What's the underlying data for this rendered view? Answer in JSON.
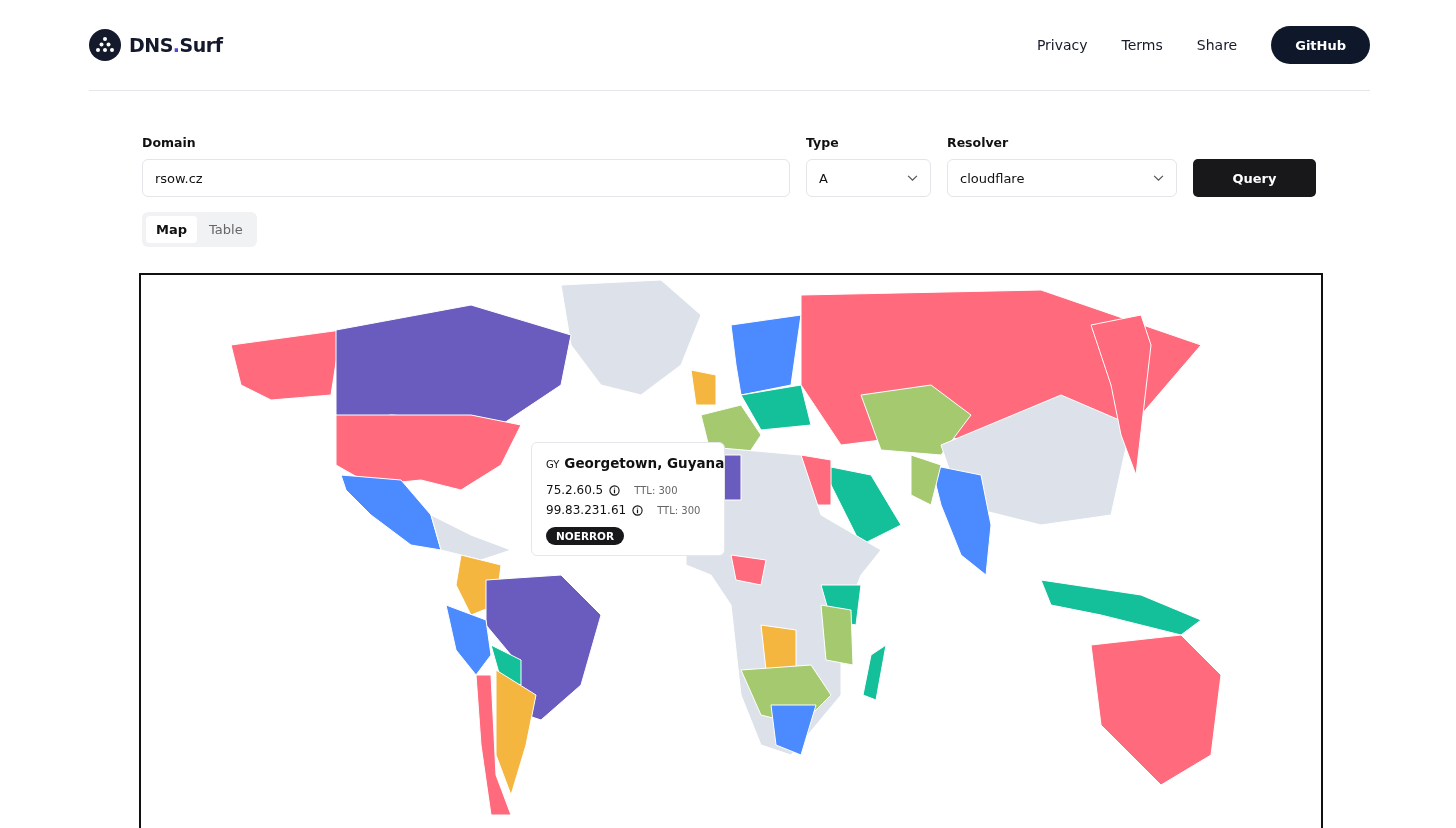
{
  "header": {
    "brand": {
      "name": "DNS",
      "dot": ".",
      "suffix": "Surf"
    },
    "nav": [
      "Privacy",
      "Terms",
      "Share"
    ],
    "cta": "GitHub"
  },
  "form": {
    "domain": {
      "label": "Domain",
      "value": "rsow.cz"
    },
    "type": {
      "label": "Type",
      "value": "A"
    },
    "resolver": {
      "label": "Resolver",
      "value": "cloudflare"
    },
    "submit": "Query"
  },
  "view_tabs": [
    {
      "label": "Map",
      "selected": true
    },
    {
      "label": "Table",
      "selected": false
    }
  ],
  "tooltip": {
    "country_code": "GY",
    "location": "Georgetown, Guyana",
    "records": [
      {
        "ip": "75.2.60.5",
        "ttl": "TTL: 300"
      },
      {
        "ip": "99.83.231.61",
        "ttl": "TTL: 300"
      }
    ],
    "status": "NOERROR"
  }
}
